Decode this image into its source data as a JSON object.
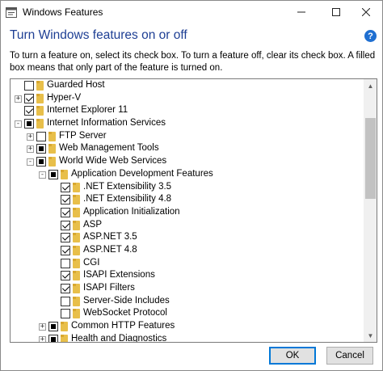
{
  "window": {
    "title": "Windows Features"
  },
  "dialog": {
    "heading": "Turn Windows features on or off",
    "instructions": "To turn a feature on, select its check box. To turn a feature off, clear its check box. A filled box means that only part of the feature is turned on.",
    "help_glyph": "?"
  },
  "features": [
    {
      "label": "Guarded Host",
      "level": 0,
      "expander": "",
      "state": "unchecked",
      "folder": true
    },
    {
      "label": "Hyper-V",
      "level": 0,
      "expander": "+",
      "state": "checked",
      "folder": true
    },
    {
      "label": "Internet Explorer 11",
      "level": 0,
      "expander": "",
      "state": "checked",
      "folder": true
    },
    {
      "label": "Internet Information Services",
      "level": 0,
      "expander": "-",
      "state": "partial",
      "folder": true
    },
    {
      "label": "FTP Server",
      "level": 1,
      "expander": "+",
      "state": "unchecked",
      "folder": true
    },
    {
      "label": "Web Management Tools",
      "level": 1,
      "expander": "+",
      "state": "partial",
      "folder": true
    },
    {
      "label": "World Wide Web Services",
      "level": 1,
      "expander": "-",
      "state": "partial",
      "folder": true
    },
    {
      "label": "Application Development Features",
      "level": 2,
      "expander": "-",
      "state": "partial",
      "folder": true
    },
    {
      "label": ".NET Extensibility 3.5",
      "level": 3,
      "expander": "",
      "state": "checked",
      "folder": true
    },
    {
      "label": ".NET Extensibility 4.8",
      "level": 3,
      "expander": "",
      "state": "checked",
      "folder": true
    },
    {
      "label": "Application Initialization",
      "level": 3,
      "expander": "",
      "state": "checked",
      "folder": true
    },
    {
      "label": "ASP",
      "level": 3,
      "expander": "",
      "state": "checked",
      "folder": true
    },
    {
      "label": "ASP.NET 3.5",
      "level": 3,
      "expander": "",
      "state": "checked",
      "folder": true
    },
    {
      "label": "ASP.NET 4.8",
      "level": 3,
      "expander": "",
      "state": "checked",
      "folder": true
    },
    {
      "label": "CGI",
      "level": 3,
      "expander": "",
      "state": "unchecked",
      "folder": true
    },
    {
      "label": "ISAPI Extensions",
      "level": 3,
      "expander": "",
      "state": "checked",
      "folder": true
    },
    {
      "label": "ISAPI Filters",
      "level": 3,
      "expander": "",
      "state": "checked",
      "folder": true
    },
    {
      "label": "Server-Side Includes",
      "level": 3,
      "expander": "",
      "state": "unchecked",
      "folder": true
    },
    {
      "label": "WebSocket Protocol",
      "level": 3,
      "expander": "",
      "state": "unchecked",
      "folder": true
    },
    {
      "label": "Common HTTP Features",
      "level": 2,
      "expander": "+",
      "state": "partial",
      "folder": true
    },
    {
      "label": "Health and Diagnostics",
      "level": 2,
      "expander": "+",
      "state": "partial",
      "folder": true
    }
  ],
  "buttons": {
    "ok": "OK",
    "cancel": "Cancel"
  }
}
